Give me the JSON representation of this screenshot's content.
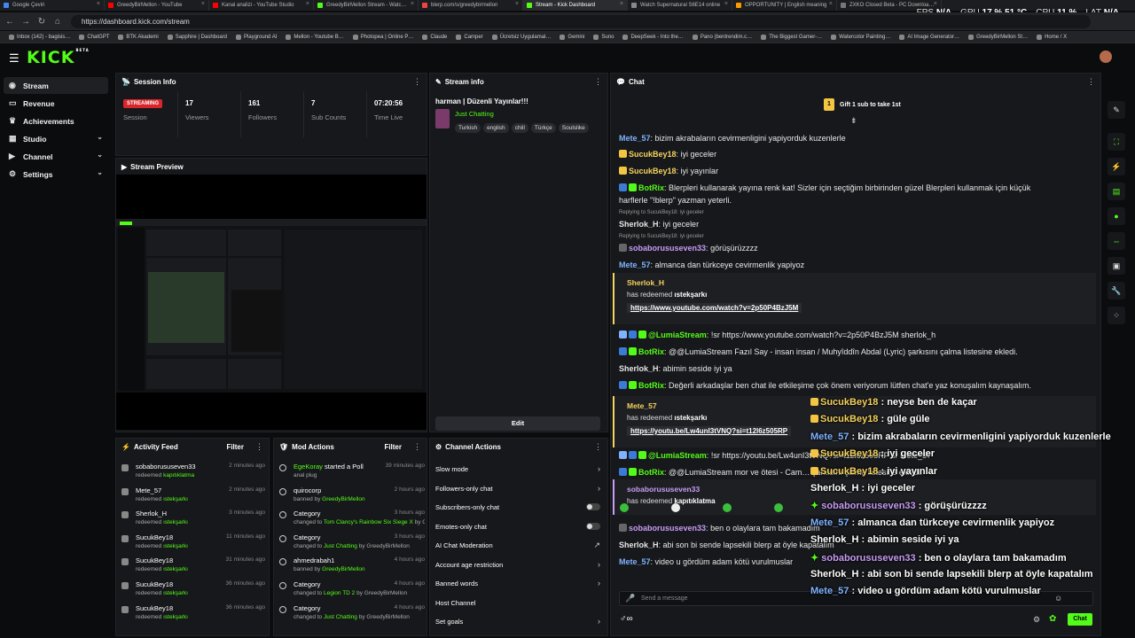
{
  "tabs": [
    {
      "label": "Google Çeviri",
      "color": "#4285f4"
    },
    {
      "label": "GreedyBirMellon - YouTube",
      "color": "#ff0000"
    },
    {
      "label": "Kanal analizi - YouTube Studio",
      "color": "#ff0000"
    },
    {
      "label": "GreedyBirMellon Stream - Watc…",
      "color": "#53fc18"
    },
    {
      "label": "blerp.com/s/greedybirmellon",
      "color": "#e44"
    },
    {
      "label": "Stream - Kick Dashboard",
      "color": "#53fc18"
    },
    {
      "label": "Watch Supernatural S6E14 online",
      "color": "#888"
    },
    {
      "label": "OPPORTUNITY | English meaning",
      "color": "#f90"
    },
    {
      "label": "ZXKO Closed Beta - PC Downloa…",
      "color": "#777"
    }
  ],
  "perf": {
    "fps_label": "FPS",
    "fps": "N/A",
    "gpu_label": "GPU",
    "gpu": "17 % 51 °C",
    "cpu_label": "CPU",
    "cpu": "11 %",
    "lat_label": "LAT",
    "lat": "N/A"
  },
  "url": "https://dashboard.kick.com/stream",
  "bookmarks": [
    "Inbox (142) - bagisis…",
    "ChatGPT",
    "BTK Akademi",
    "Sapphire | Dashboard",
    "Playground AI",
    "Mellon - Youtube B…",
    "Photopea | Online P…",
    "Claude",
    "Camper",
    "Ücretsiz Uygulamal…",
    "Gemini",
    "Suno",
    "DeepSeek - Into the…",
    "Pano (bentrendim.c…",
    "The Biggest Gamer-…",
    "Watercolor Painting…",
    "AI Image Generator…",
    "GreedyBirMellon St…",
    "Home / X"
  ],
  "logo": "KICK",
  "logo_sup": "BETA",
  "sidebar": [
    {
      "label": "Stream",
      "icon": "broadcast-icon",
      "active": true
    },
    {
      "label": "Revenue",
      "icon": "wallet-icon"
    },
    {
      "label": "Achievements",
      "icon": "trophy-icon"
    },
    {
      "label": "Studio",
      "icon": "studio-icon",
      "chev": "⌄"
    },
    {
      "label": "Channel",
      "icon": "channel-icon",
      "chev": "⌄"
    },
    {
      "label": "Settings",
      "icon": "gear-icon",
      "chev": "⌄"
    }
  ],
  "session": {
    "title": "Session Info",
    "badge": "STREAMING",
    "session_label": "Session",
    "stats": [
      {
        "v": "17",
        "l": "Viewers"
      },
      {
        "v": "161",
        "l": "Followers"
      },
      {
        "v": "7",
        "l": "Sub Counts"
      },
      {
        "v": "07:20:56",
        "l": "Time Live"
      }
    ]
  },
  "preview": {
    "title": "Stream Preview"
  },
  "streaminfo": {
    "title": "Stream info",
    "stream_title": "harman | Düzenli Yayınlar!!!",
    "category": "Just Chatting",
    "tags": [
      "Turkish",
      "english",
      "chill",
      "Türkçe",
      "Soulslike"
    ],
    "edit": "Edit"
  },
  "activity": {
    "title": "Activity Feed",
    "filter": "Filter",
    "items": [
      {
        "n": "sobaborususeven33",
        "a": "redeemed",
        "r": "kapıtıklatma",
        "t": "2 minutes ago"
      },
      {
        "n": "Mete_57",
        "a": "redeemed",
        "r": "ıstekşarkı",
        "t": "2 minutes ago"
      },
      {
        "n": "Sherlok_H",
        "a": "redeemed",
        "r": "ıstekşarkı",
        "t": "3 minutes ago"
      },
      {
        "n": "SucukBey18",
        "a": "redeemed",
        "r": "ıstekşarkı",
        "t": "11 minutes ago"
      },
      {
        "n": "SucukBey18",
        "a": "redeemed",
        "r": "ıstekşarkı",
        "t": "31 minutes ago"
      },
      {
        "n": "SucukBey18",
        "a": "redeemed",
        "r": "ıstekşarkı",
        "t": "36 minutes ago"
      },
      {
        "n": "SucukBey18",
        "a": "redeemed",
        "r": "ıstekşarkı",
        "t": "36 minutes ago"
      }
    ]
  },
  "modactions": {
    "title": "Mod Actions",
    "filter": "Filter",
    "items": [
      {
        "n1": "EgeKoray",
        "n2": " started a Poll",
        "s1": "anal plug",
        "s2": "",
        "s3": "",
        "t": "39 minutes ago"
      },
      {
        "n1": "",
        "n2": "quirocorp",
        "s1": "banned by ",
        "s2": "GreedyBirMellon",
        "s3": "",
        "t": "2 hours ago"
      },
      {
        "n1": "",
        "n2": "Category",
        "s1": "changed to ",
        "s2": "Tom Clancy's Rainbow Six Siege X",
        "s3": " by GreedyBirMellon",
        "t": "3 hours ago"
      },
      {
        "n1": "",
        "n2": "Category",
        "s1": "changed to ",
        "s2": "Just Chatting",
        "s3": " by GreedyBirMellon",
        "t": "3 hours ago"
      },
      {
        "n1": "",
        "n2": "ahmedrabah1",
        "s1": "banned by ",
        "s2": "GreedyBirMellon",
        "s3": "",
        "t": "4 hours ago"
      },
      {
        "n1": "",
        "n2": "Category",
        "s1": "changed to ",
        "s2": "Legion TD 2",
        "s3": " by GreedyBirMellon",
        "t": "4 hours ago"
      },
      {
        "n1": "",
        "n2": "Category",
        "s1": "changed to ",
        "s2": "Just Chatting",
        "s3": " by GreedyBirMellon",
        "t": "4 hours ago"
      }
    ]
  },
  "channelactions": {
    "title": "Channel Actions",
    "items": [
      {
        "label": "Slow mode",
        "ctl": "arrow"
      },
      {
        "label": "Followers-only chat",
        "ctl": "arrow"
      },
      {
        "label": "Subscribers-only chat",
        "ctl": "toggle"
      },
      {
        "label": "Emotes-only chat",
        "ctl": "toggle"
      },
      {
        "label": "AI Chat Moderation",
        "ctl": "ext"
      },
      {
        "label": "Account age restriction",
        "ctl": "arrow"
      },
      {
        "label": "Banned words",
        "ctl": "arrow"
      },
      {
        "label": "Host Channel",
        "ctl": "none"
      },
      {
        "label": "Set goals",
        "ctl": "arrow"
      }
    ]
  },
  "chat": {
    "title": "Chat",
    "gift": "Gift 1 sub to take 1st",
    "gift_count": "1",
    "input_placeholder": "Send a message",
    "send": "Chat",
    "msgs": [
      {
        "u": "Mete_57",
        "c": "ub",
        "t": "bizim akrabaların cevirmenligini yapiyorduk kuzenlerle"
      },
      {
        "u": "SucukBey18",
        "c": "uy",
        "t": "iyi geceler"
      },
      {
        "u": "SucukBey18",
        "c": "uy",
        "t": "iyi yayınlar"
      },
      {
        "u": "BotRix",
        "c": "ug",
        "t": "Blerpleri kullanarak yayına renk kat! Sizler için seçtiğim birbirinden güzel Blerpleri kullanmak için küçük"
      },
      {
        "u": "",
        "c": "",
        "t": "harflerle \"!blerp\" yazman yeterli."
      },
      {
        "u": "Sherlok_H",
        "c": "uw",
        "t": "iyi geceler"
      },
      {
        "u": "sobaborususeven33",
        "c": "up",
        "t": "görüşürüzzzz"
      },
      {
        "u": "Mete_57",
        "c": "ub",
        "t": "almanca dan türkceye cevirmenlik yapiyoz"
      },
      {
        "u": "@LumiaStream",
        "c": "ug",
        "t": "!sr https://www.youtube.com/watch?v=2p50P4BzJ5M sherlok_h"
      },
      {
        "u": "BotRix",
        "c": "ug",
        "t": "@@LumiaStream Fazıl Say - insan insan / Muhyîddîn Abdal (Lyric) şarkısını çalma listesine ekledi."
      },
      {
        "u": "Sherlok_H",
        "c": "uw",
        "t": "abimin seside iyi ya"
      },
      {
        "u": "BotRix",
        "c": "ug",
        "t": "Değerli arkadaşlar ben chat ile etkileşime çok önem veriyorum lütfen chat'e yaz konuşalım kaynaşalım."
      },
      {
        "u": "@LumiaStream",
        "c": "ug",
        "t": "!sr https://youtu.be/Lw4unI3tVNQ?si=t12l6z505RP sr Mete_57"
      },
      {
        "u": "BotRix",
        "c": "ug",
        "t": "@@LumiaStream mor ve ötesi - Cam… şarkısını çalma listesine ekledi."
      },
      {
        "u": "sobaborususeven33",
        "c": "up",
        "t": "ben o olaylara tam bakamadım"
      },
      {
        "u": "Sherlok_H",
        "c": "uw",
        "t": "abi son bi sende lapsekili blerp at öyle kapatalım"
      },
      {
        "u": "Mete_57",
        "c": "ub",
        "t": "video u gördüm adam kötü vurulmuslar"
      }
    ],
    "replies": [
      "Replying to SucukBey18: iyi geceler",
      "Replying to SucukBey18: iyi geceler"
    ],
    "redeems": [
      {
        "u": "Sherlok_H",
        "c": "#f4d35e",
        "has": "has redeemed ",
        "r": "ıstekşarkı",
        "link": "https://www.youtube.com/watch?v=2p50P4BzJ5M"
      },
      {
        "u": "Mete_57",
        "c": "#f4d35e",
        "has": "has redeemed ",
        "r": "ıstekşarkı",
        "link": "https://youtu.be/Lw4unI3tVNQ?si=t12l6z505RP"
      },
      {
        "u": "sobaborususeven33",
        "c": "#c79cf5",
        "has": "has redeemed ",
        "r": "kapıtıklatma",
        "link": ""
      }
    ]
  },
  "overlay": [
    {
      "u": "SucukBey18",
      "c": "uy",
      "t": " : neyse ben de kaçar"
    },
    {
      "u": "SucukBey18",
      "c": "uy",
      "t": " : güle güle"
    },
    {
      "u": "Mete_57",
      "c": "ub",
      "t": " : bizim akrabaların cevirmenligini yapiyorduk kuzenlerle"
    },
    {
      "u": "SucukBey18",
      "c": "uy",
      "t": " : iyi geceler"
    },
    {
      "u": "SucukBey18",
      "c": "uy",
      "t": " : iyi yayınlar"
    },
    {
      "u": "Sherlok_H",
      "c": "u",
      "t": " : iyi geceler"
    },
    {
      "u": "sobaborususeven33",
      "c": "up",
      "t": " : görüşürüzzzz"
    },
    {
      "u": "Mete_57",
      "c": "ub",
      "t": " : almanca dan türkceye cevirmenlik yapiyoz"
    },
    {
      "u": "Sherlok_H",
      "c": "u",
      "t": " : abimin seside iyi ya"
    },
    {
      "u": "sobaborususeven33",
      "c": "up",
      "t": " : ben o olaylara tam bakamadım"
    },
    {
      "u": "Sherlok_H",
      "c": "u",
      "t": " : abi son bi sende lapsekili blerp at öyle kapatalım"
    },
    {
      "u": "Mete_57",
      "c": "ub",
      "t": " : video u gördüm adam kötü vurulmuslar"
    }
  ],
  "colors": {
    "accent": "#53fc18",
    "live": "#d8262c"
  }
}
